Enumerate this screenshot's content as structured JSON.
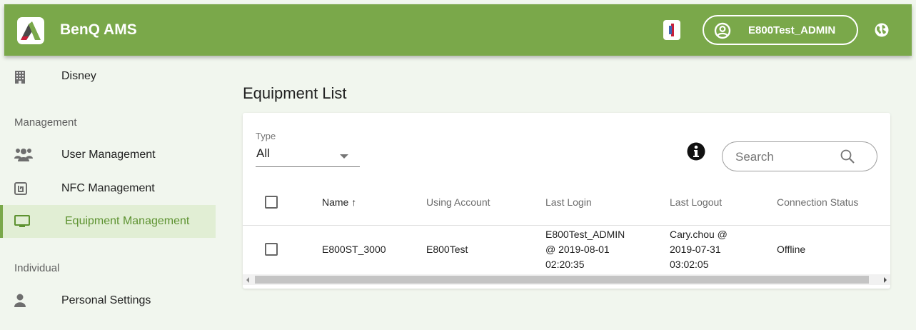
{
  "header": {
    "app_title": "BenQ AMS",
    "account_name": "E800Test_ADMIN",
    "brand_color": "#7aa84a",
    "icons": [
      "app-logo",
      "alert-icon",
      "account-avatar-icon",
      "globe-icon"
    ]
  },
  "sidebar": {
    "org": {
      "label": "Disney",
      "icon": "building-icon"
    },
    "sections": [
      {
        "title": "Management",
        "items": [
          {
            "label": "User Management",
            "icon": "users-icon"
          },
          {
            "label": "NFC Management",
            "icon": "nfc-icon"
          },
          {
            "label": "Equipment Management",
            "icon": "monitor-icon",
            "active": true
          }
        ]
      },
      {
        "title": "Individual",
        "items": [
          {
            "label": "Personal Settings",
            "icon": "person-icon"
          }
        ]
      }
    ]
  },
  "main": {
    "title": "Equipment List",
    "filter": {
      "label": "Type",
      "value": "All"
    },
    "search": {
      "placeholder": "Search"
    },
    "table": {
      "columns": [
        "Name ↑",
        "Using Account",
        "Last Login",
        "Last Logout",
        "Connection Status"
      ],
      "rows": [
        {
          "name": "E800ST_3000",
          "using_account": "E800Test",
          "last_login": [
            "E800Test_ADMIN",
            "@ 2019-08-01",
            "02:20:35"
          ],
          "last_logout": [
            "Cary.chou @",
            "2019-07-31",
            "03:02:05"
          ],
          "status": "Offline"
        }
      ]
    }
  }
}
